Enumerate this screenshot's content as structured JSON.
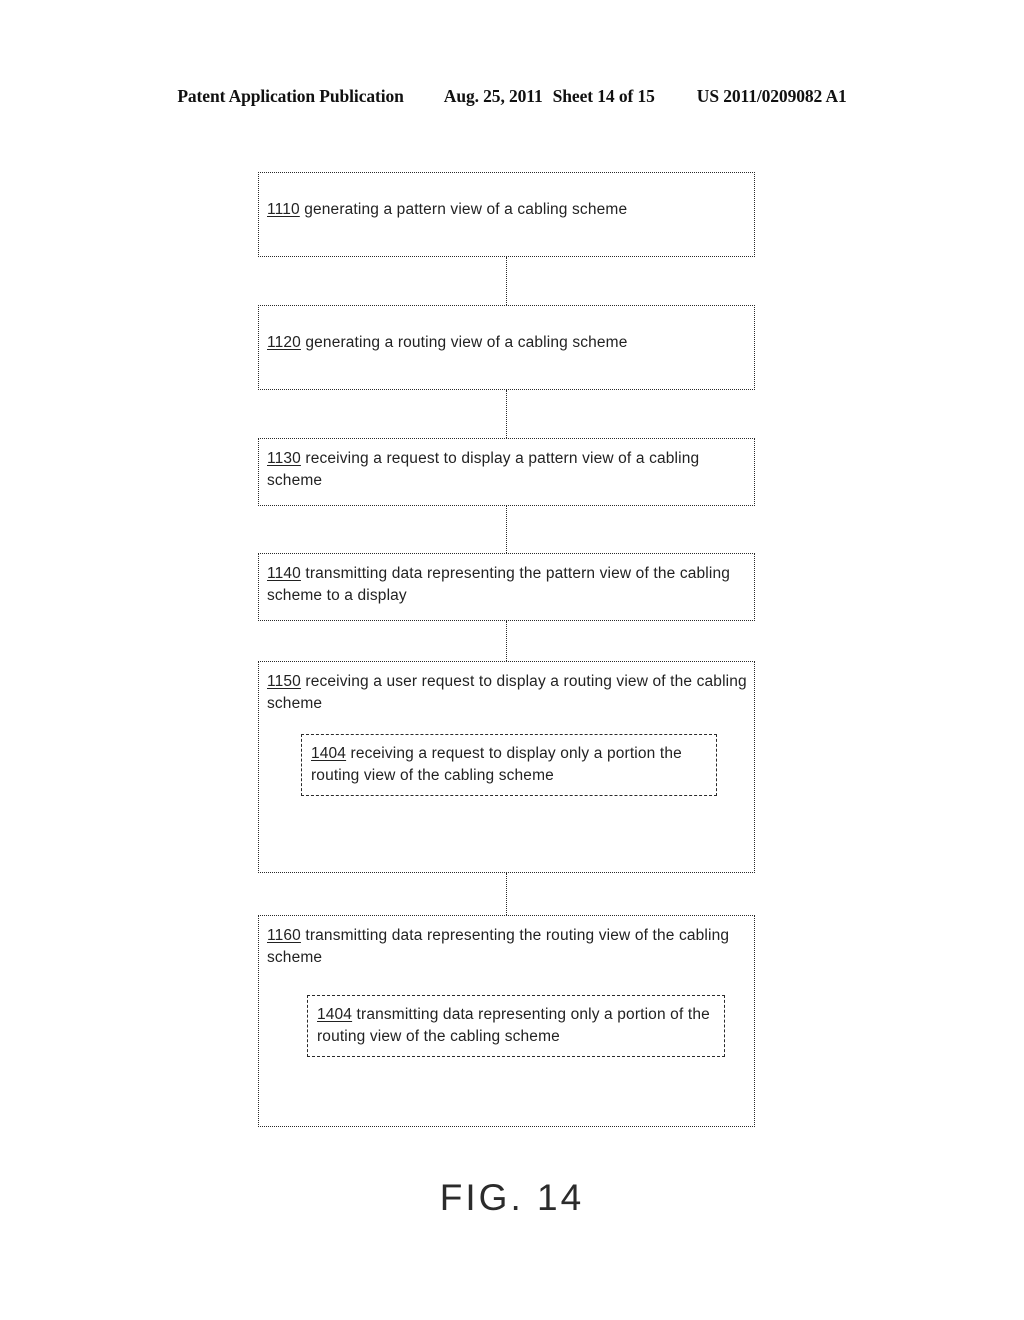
{
  "header": {
    "publication": "Patent Application Publication",
    "date": "Aug. 25, 2011",
    "sheet": "Sheet 14 of 15",
    "patent_number": "US 2011/0209082 A1"
  },
  "figure": {
    "caption": "FIG. 14"
  },
  "flowchart": {
    "steps": [
      {
        "ref": "1110",
        "text": " generating a pattern view of a cabling scheme"
      },
      {
        "ref": "1120",
        "text": " generating a routing view of a cabling scheme"
      },
      {
        "ref": "1130",
        "text": " receiving a request to display a pattern view of a cabling scheme"
      },
      {
        "ref": "1140",
        "text": " transmitting data representing the pattern view of the cabling scheme to a display"
      },
      {
        "ref": "1150",
        "text": " receiving a user request to display a routing view of the cabling scheme"
      },
      {
        "ref": "1160",
        "text": " transmitting data representing the routing view of the cabling scheme"
      }
    ],
    "substeps": [
      {
        "ref": "1404",
        "text": " receiving a request to display only a portion the routing view of the cabling scheme"
      },
      {
        "ref": "1404",
        "text": " transmitting data representing only a portion of the routing view of the cabling scheme"
      }
    ]
  }
}
